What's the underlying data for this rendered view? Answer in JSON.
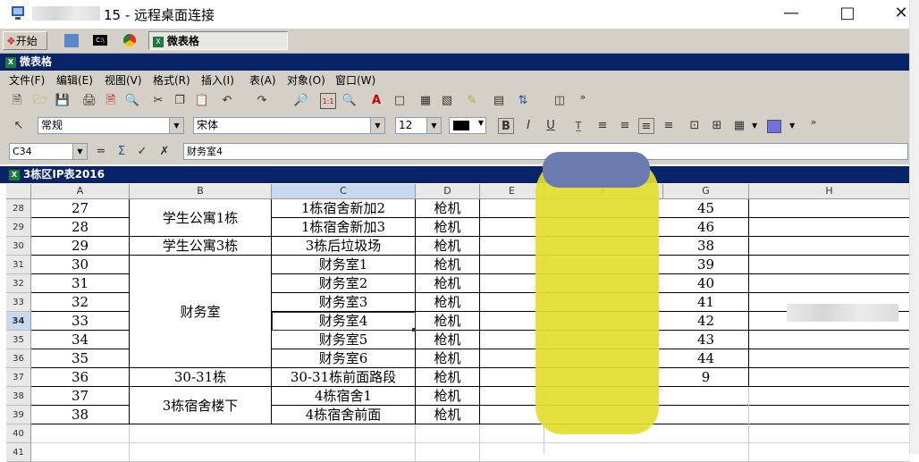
{
  "rdp": {
    "title_suffix": "15 - 远程桌面连接"
  },
  "taskbar": {
    "start": "开始",
    "active_app": "微表格"
  },
  "app": {
    "title": "微表格"
  },
  "menu": [
    "文件(F)",
    "编辑(E)",
    "视图(V)",
    "格式(R)",
    "插入(I)",
    "表(A)",
    "对象(O)",
    "窗口(W)"
  ],
  "toolbar2": {
    "style": "常规",
    "font": "宋体",
    "size": "12"
  },
  "formula": {
    "cellref": "C34",
    "value": "财务室4"
  },
  "doc": {
    "title": "3栋区IP表2016"
  },
  "grid": {
    "columns": [
      "A",
      "B",
      "C",
      "D",
      "E",
      "F",
      "G",
      "H"
    ],
    "rows": [
      {
        "n": "28",
        "a": "27",
        "c": "1栋宿舍新加2",
        "d": "枪机",
        "g": "45"
      },
      {
        "n": "29",
        "a": "28",
        "c": "1栋宿舍新加3",
        "d": "枪机",
        "g": "46"
      },
      {
        "n": "30",
        "a": "29",
        "c": "3栋后垃圾场",
        "d": "枪机",
        "g": "38"
      },
      {
        "n": "31",
        "a": "30",
        "c": "财务室1",
        "d": "枪机",
        "g": "39"
      },
      {
        "n": "32",
        "a": "31",
        "c": "财务室2",
        "d": "枪机",
        "g": "40"
      },
      {
        "n": "33",
        "a": "32",
        "c": "财务室3",
        "d": "枪机",
        "g": "41"
      },
      {
        "n": "34",
        "a": "33",
        "c": "财务室4",
        "d": "枪机",
        "g": "42"
      },
      {
        "n": "35",
        "a": "34",
        "c": "财务室5",
        "d": "枪机",
        "g": "43"
      },
      {
        "n": "36",
        "a": "35",
        "c": "财务室6",
        "d": "枪机",
        "g": "44"
      },
      {
        "n": "37",
        "a": "36",
        "c": "30-31栋前面路段",
        "d": "枪机",
        "g": "9"
      },
      {
        "n": "38",
        "a": "37",
        "c": "4栋宿舍1",
        "d": "枪机",
        "g": ""
      },
      {
        "n": "39",
        "a": "38",
        "c": "4栋宿舍前面",
        "d": "枪机",
        "g": ""
      },
      {
        "n": "40",
        "a": "",
        "c": "",
        "d": "",
        "g": ""
      },
      {
        "n": "41",
        "a": "",
        "c": "",
        "d": "",
        "g": ""
      }
    ],
    "merged_b": [
      {
        "text": "学生公寓1栋",
        "start": 0,
        "span": 2
      },
      {
        "text": "学生公寓3栋",
        "start": 2,
        "span": 1
      },
      {
        "text": "财务室",
        "start": 3,
        "span": 6
      },
      {
        "text": "30-31栋",
        "start": 9,
        "span": 1
      },
      {
        "text": "3栋宿舍楼下",
        "start": 10,
        "span": 2
      }
    ]
  },
  "colors": {
    "titlebar": "#0a246a",
    "redaction": "#e0dc2a",
    "chrome": "#d4d0c8"
  }
}
